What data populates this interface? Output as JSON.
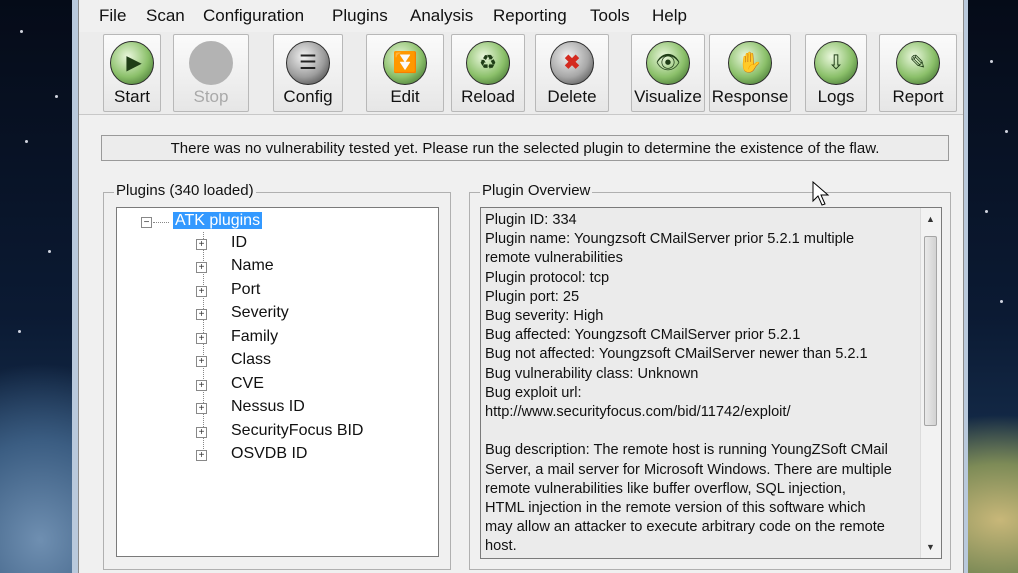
{
  "menu": [
    "File",
    "Scan",
    "Configuration",
    "Plugins",
    "Analysis",
    "Reporting",
    "Tools",
    "Help"
  ],
  "toolbar": {
    "start": "Start",
    "stop": "Stop",
    "config": "Config",
    "edit": "Edit",
    "reload": "Reload",
    "delete": "Delete",
    "visualize": "Visualize",
    "response": "Response",
    "logs": "Logs",
    "report": "Report"
  },
  "status_message": "There was no vulnerability tested yet. Please run the selected plugin to determine the existence of the flaw.",
  "plugins_panel": {
    "title": "Plugins (340 loaded)",
    "root": "ATK plugins",
    "nodes": [
      "ID",
      "Name",
      "Port",
      "Severity",
      "Family",
      "Class",
      "CVE",
      "Nessus ID",
      "SecurityFocus BID",
      "OSVDB ID"
    ]
  },
  "overview_panel": {
    "title": "Plugin Overview",
    "lines": [
      "Plugin ID: 334",
      "Plugin name: Youngzsoft CMailServer prior 5.2.1 multiple",
      "remote vulnerabilities",
      "Plugin protocol: tcp",
      "Plugin port: 25",
      "Bug severity: High",
      "Bug affected: Youngzsoft CMailServer prior 5.2.1",
      "Bug not affected: Youngzsoft CMailServer newer than 5.2.1",
      "Bug vulnerability class: Unknown",
      "Bug exploit url:",
      "http://www.securityfocus.com/bid/11742/exploit/",
      "",
      "Bug description: The remote host is running YoungZSoft CMail",
      "Server, a mail server for Microsoft Windows. There are multiple",
      "remote vulnerabilities like buffer overflow, SQL injection,",
      "HTML injection in the remote version of this software which",
      "may allow an attacker to execute arbitrary code on the remote",
      "host."
    ]
  }
}
